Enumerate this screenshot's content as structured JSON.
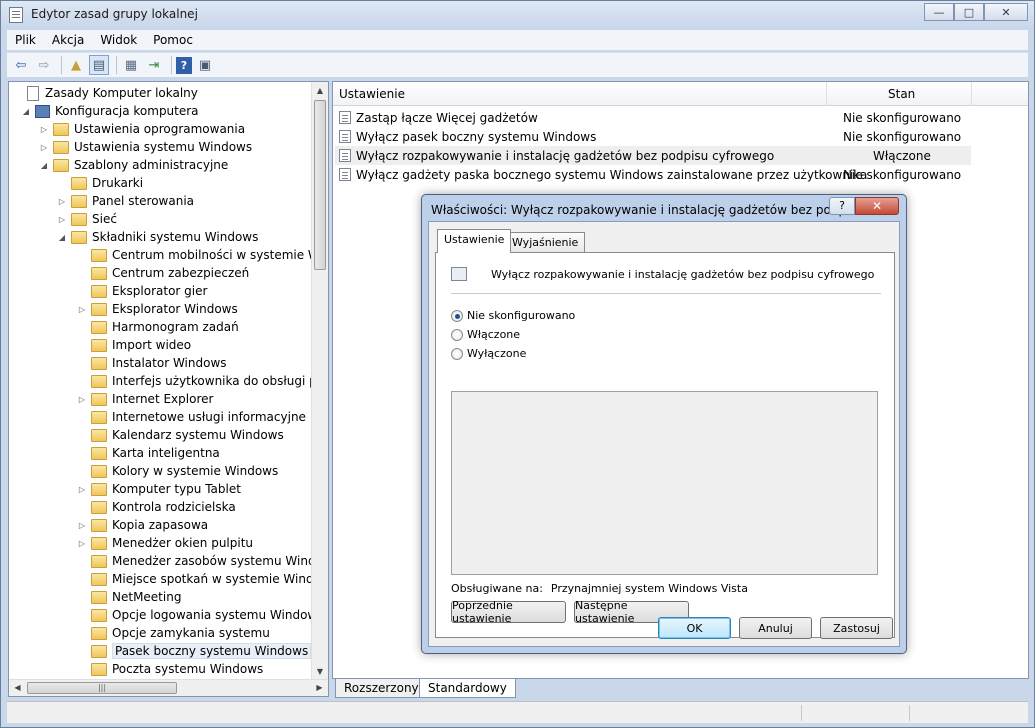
{
  "window": {
    "title": "Edytor zasad grupy lokalnej",
    "caption": {
      "minimize": "—",
      "maximize": "□",
      "close": "✕"
    }
  },
  "menu": [
    "Plik",
    "Akcja",
    "Widok",
    "Pomoc"
  ],
  "toolbar": [
    "back-icon",
    "forward-icon",
    "up-folder-icon",
    "show-hide-tree-icon",
    "properties-icon",
    "export-list-icon",
    "help-icon",
    "filter-view-icon"
  ],
  "tree": {
    "items": [
      {
        "label": "Zasady Komputer lokalny",
        "level": 0,
        "twisty": "",
        "icon": "doc"
      },
      {
        "label": "Konfiguracja komputera",
        "level": 1,
        "twisty": "◢",
        "icon": "pc"
      },
      {
        "label": "Ustawienia oprogramowania",
        "level": 2,
        "twisty": "▷",
        "icon": "folder"
      },
      {
        "label": "Ustawienia systemu Windows",
        "level": 2,
        "twisty": "▷",
        "icon": "folder"
      },
      {
        "label": "Szablony administracyjne",
        "level": 2,
        "twisty": "◢",
        "icon": "folder"
      },
      {
        "label": "Drukarki",
        "level": 3,
        "twisty": "",
        "icon": "folder"
      },
      {
        "label": "Panel sterowania",
        "level": 3,
        "twisty": "▷",
        "icon": "folder"
      },
      {
        "label": "Sieć",
        "level": 3,
        "twisty": "▷",
        "icon": "folder"
      },
      {
        "label": "Składniki systemu Windows",
        "level": 3,
        "twisty": "◢",
        "icon": "folder"
      },
      {
        "label": "Centrum mobilności w systemie Windows",
        "level": 4,
        "twisty": "",
        "icon": "folder"
      },
      {
        "label": "Centrum zabezpieczeń",
        "level": 4,
        "twisty": "",
        "icon": "folder"
      },
      {
        "label": "Eksplorator gier",
        "level": 4,
        "twisty": "",
        "icon": "folder"
      },
      {
        "label": "Eksplorator Windows",
        "level": 4,
        "twisty": "▷",
        "icon": "folder"
      },
      {
        "label": "Harmonogram zadań",
        "level": 4,
        "twisty": "",
        "icon": "folder"
      },
      {
        "label": "Import wideo",
        "level": 4,
        "twisty": "",
        "icon": "folder"
      },
      {
        "label": "Instalator Windows",
        "level": 4,
        "twisty": "",
        "icon": "folder"
      },
      {
        "label": "Interfejs użytkownika do obsługi pośw",
        "level": 4,
        "twisty": "",
        "icon": "folder"
      },
      {
        "label": "Internet Explorer",
        "level": 4,
        "twisty": "▷",
        "icon": "folder"
      },
      {
        "label": "Internetowe usługi informacyjne",
        "level": 4,
        "twisty": "",
        "icon": "folder"
      },
      {
        "label": "Kalendarz systemu Windows",
        "level": 4,
        "twisty": "",
        "icon": "folder"
      },
      {
        "label": "Karta inteligentna",
        "level": 4,
        "twisty": "",
        "icon": "folder"
      },
      {
        "label": "Kolory w systemie Windows",
        "level": 4,
        "twisty": "",
        "icon": "folder"
      },
      {
        "label": "Komputer typu Tablet",
        "level": 4,
        "twisty": "▷",
        "icon": "folder"
      },
      {
        "label": "Kontrola rodzicielska",
        "level": 4,
        "twisty": "",
        "icon": "folder"
      },
      {
        "label": "Kopia zapasowa",
        "level": 4,
        "twisty": "▷",
        "icon": "folder"
      },
      {
        "label": "Menedżer okien pulpitu",
        "level": 4,
        "twisty": "▷",
        "icon": "folder"
      },
      {
        "label": "Menedżer zasobów systemu Windows",
        "level": 4,
        "twisty": "",
        "icon": "folder"
      },
      {
        "label": "Miejsce spotkań w systemie Windows",
        "level": 4,
        "twisty": "",
        "icon": "folder"
      },
      {
        "label": "NetMeeting",
        "level": 4,
        "twisty": "",
        "icon": "folder"
      },
      {
        "label": "Opcje logowania systemu Windows",
        "level": 4,
        "twisty": "",
        "icon": "folder"
      },
      {
        "label": "Opcje zamykania systemu",
        "level": 4,
        "twisty": "",
        "icon": "folder"
      },
      {
        "label": "Pasek boczny systemu Windows",
        "level": 4,
        "twisty": "",
        "icon": "folder",
        "selected": true
      },
      {
        "label": "Poczta systemu Windows",
        "level": 4,
        "twisty": "",
        "icon": "folder"
      }
    ]
  },
  "list": {
    "columns": {
      "setting": "Ustawienie",
      "state": "Stan"
    },
    "rows": [
      {
        "setting": "Zastąp łącze Więcej gadżetów",
        "state": "Nie skonfigurowano"
      },
      {
        "setting": "Wyłącz pasek boczny systemu Windows",
        "state": "Nie skonfigurowano"
      },
      {
        "setting": "Wyłącz rozpakowywanie i instalację gadżetów bez podpisu cyfrowego",
        "state": "Włączone",
        "highlighted": true
      },
      {
        "setting": "Wyłącz gadżety paska bocznego systemu Windows zainstalowane przez użytkownika",
        "state": "Nie skonfigurowano"
      }
    ]
  },
  "bottom_tabs": [
    "Rozszerzony",
    "Standardowy"
  ],
  "dialog": {
    "title": "Właściwości: Wyłącz rozpakowywanie i instalację gadżetów bez podpisu ...",
    "help": "?",
    "close": "✕",
    "tabs": [
      "Ustawienie",
      "Wyjaśnienie"
    ],
    "policy_name": "Wyłącz rozpakowywanie i instalację gadżetów bez podpisu cyfrowego",
    "options": [
      {
        "label": "Nie skonfigurowano",
        "checked": true
      },
      {
        "label": "Włączone",
        "checked": false
      },
      {
        "label": "Wyłączone",
        "checked": false
      }
    ],
    "supported_label": "Obsługiwane na:",
    "supported_value": "Przynajmniej system Windows Vista",
    "prev_button": "Poprzednie ustawienie",
    "next_button": "Następne ustawienie",
    "ok": "OK",
    "cancel": "Anuluj",
    "apply": "Zastosuj"
  }
}
